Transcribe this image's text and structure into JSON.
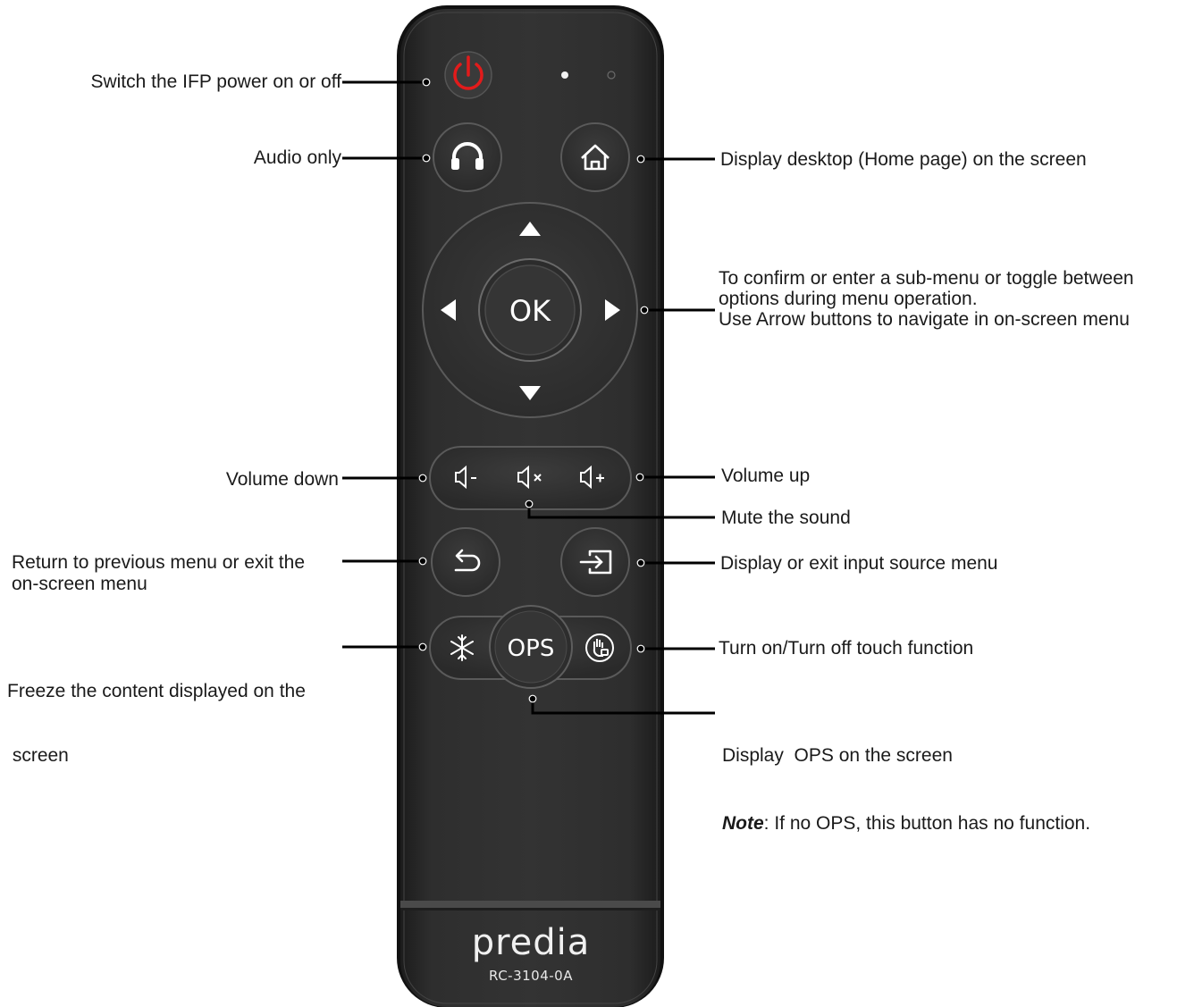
{
  "remote": {
    "brand": "predia",
    "model": "RC-3104-0A",
    "ok_label": "OK",
    "ops_label": "OPS",
    "colors": {
      "body": "#2a2a2a",
      "body_edge": "#1a1a1a",
      "button": "#333333",
      "button_ring": "#5a5a5a",
      "power_accent": "#e02020",
      "glyph": "#ffffff"
    },
    "buttons": [
      {
        "id": "power",
        "icon": "power-icon"
      },
      {
        "id": "audio-only",
        "icon": "headphones-icon"
      },
      {
        "id": "home",
        "icon": "home-icon"
      },
      {
        "id": "up",
        "icon": "arrow-up-icon"
      },
      {
        "id": "down",
        "icon": "arrow-down-icon"
      },
      {
        "id": "left",
        "icon": "arrow-left-icon"
      },
      {
        "id": "right",
        "icon": "arrow-right-icon"
      },
      {
        "id": "ok",
        "icon": "ok-label"
      },
      {
        "id": "volume-down",
        "icon": "volume-down-icon"
      },
      {
        "id": "mute",
        "icon": "mute-icon"
      },
      {
        "id": "volume-up",
        "icon": "volume-up-icon"
      },
      {
        "id": "return",
        "icon": "return-icon"
      },
      {
        "id": "input-source",
        "icon": "input-source-icon"
      },
      {
        "id": "freeze",
        "icon": "snowflake-icon"
      },
      {
        "id": "ops",
        "icon": "ops-label"
      },
      {
        "id": "touch",
        "icon": "touch-lock-icon"
      }
    ]
  },
  "callouts": {
    "power": "Switch the IFP power on or off",
    "audio_only": "Audio only",
    "home": "Display desktop (Home page) on the screen",
    "nav_line1": "To confirm or enter a sub-menu or toggle between",
    "nav_line2": "options during menu operation.",
    "nav_line3": "Use Arrow buttons to navigate in on-screen menu",
    "volume_down": "Volume down",
    "volume_up": "Volume up",
    "mute": "Mute the sound",
    "return_line1": "Return to previous menu or exit the",
    "return_line2": "on-screen menu",
    "input": "Display or exit input source menu",
    "freeze_line1": "Freeze the content displayed on the",
    "freeze_line2": " screen",
    "touch": "Turn on/Turn off touch function",
    "ops_line1": "Display  OPS on the screen",
    "ops_note_label": "Note",
    "ops_note_text": ": If no OPS, this button has no function."
  }
}
